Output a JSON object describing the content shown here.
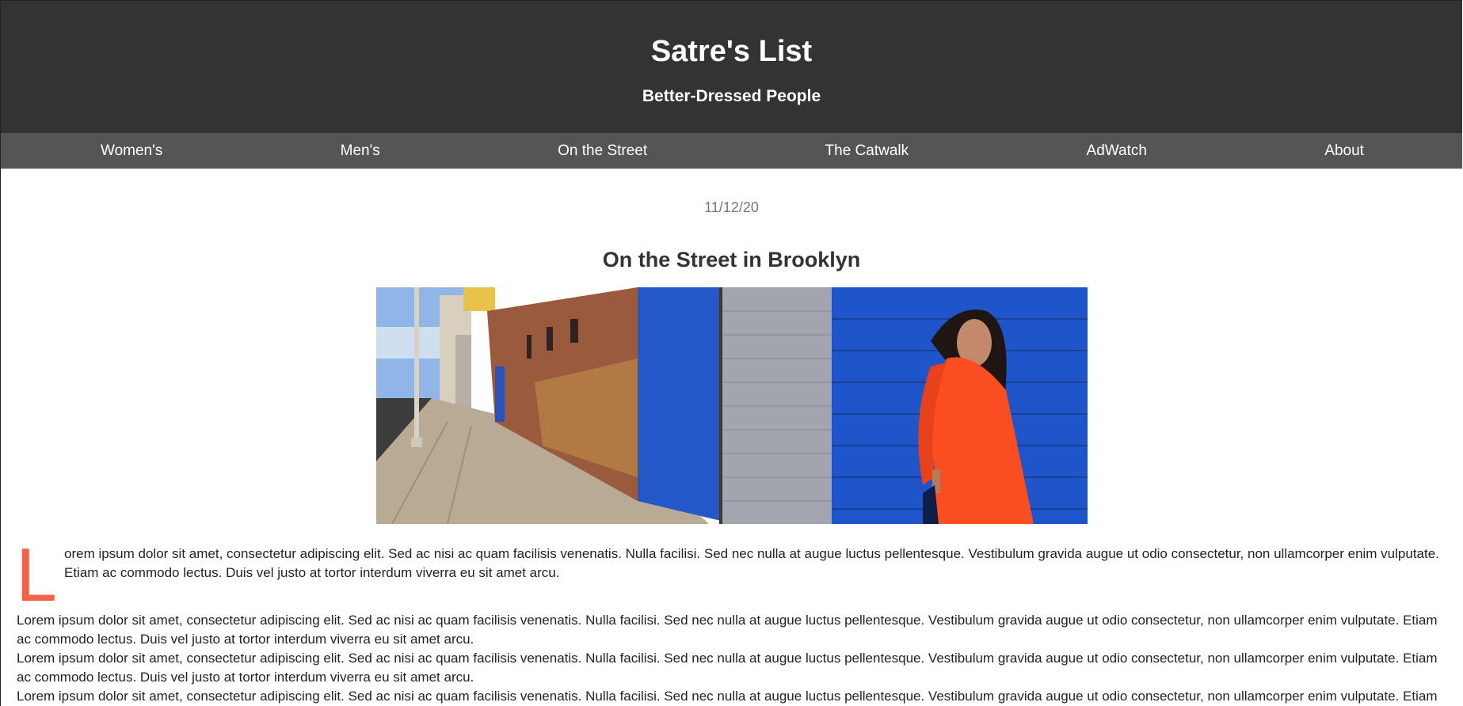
{
  "header": {
    "title": "Satre's List",
    "tagline": "Better-Dressed People"
  },
  "nav": {
    "items": [
      {
        "label": "Women's"
      },
      {
        "label": "Men's"
      },
      {
        "label": "On the Street"
      },
      {
        "label": "The Catwalk"
      },
      {
        "label": "AdWatch"
      },
      {
        "label": "About"
      }
    ]
  },
  "article": {
    "date": "11/12/20",
    "title": "On the Street in Brooklyn",
    "drop_cap": "L",
    "lead_text": "orem ipsum dolor sit amet, consectetur adipiscing elit. Sed ac nisi ac quam facilisis venenatis. Nulla facilisi. Sed nec nulla at augue luctus pellentesque. Vestibulum gravida augue ut odio consectetur, non ullamcorper enim vulputate. Etiam ac commodo lectus. Duis vel justo at tortor interdum viverra eu sit amet arcu.",
    "paragraphs": [
      "Lorem ipsum dolor sit amet, consectetur adipiscing elit. Sed ac nisi ac quam facilisis venenatis. Nulla facilisi. Sed nec nulla at augue luctus pellentesque. Vestibulum gravida augue ut odio consectetur, non ullamcorper enim vulputate. Etiam ac commodo lectus. Duis vel justo at tortor interdum viverra eu sit amet arcu.",
      "Lorem ipsum dolor sit amet, consectetur adipiscing elit. Sed ac nisi ac quam facilisis venenatis. Nulla facilisi. Sed nec nulla at augue luctus pellentesque. Vestibulum gravida augue ut odio consectetur, non ullamcorper enim vulputate. Etiam ac commodo lectus. Duis vel justo at tortor interdum viverra eu sit amet arcu.",
      "Lorem ipsum dolor sit amet, consectetur adipiscing elit. Sed ac nisi ac quam facilisis venenatis. Nulla facilisi. Sed nec nulla at augue luctus pellentesque. Vestibulum gravida augue ut odio consectetur, non ullamcorper enim vulputate. Etiam ac commodo lectus. Duis vel justo at tortor interdum viverra eu sit amet arcu."
    ]
  },
  "colors": {
    "header_bg": "#333333",
    "nav_bg": "#555555",
    "drop_cap": "#f26148",
    "dress": "#fb4d22",
    "wall_blue": "#1f55c8"
  }
}
